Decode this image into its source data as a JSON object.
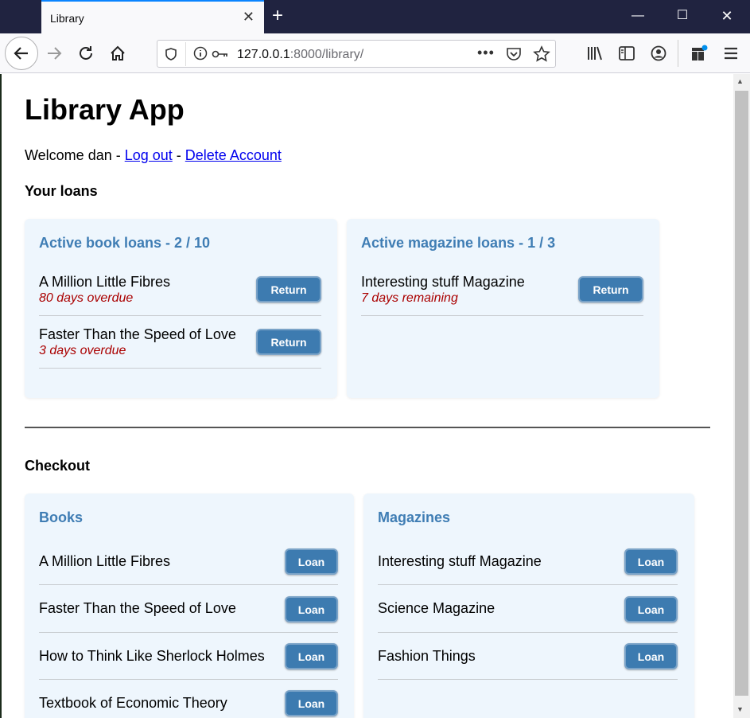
{
  "browser": {
    "tab_title": "Library",
    "url_host": "127.0.0.1",
    "url_rest": ":8000/library/"
  },
  "page": {
    "title": "Library App",
    "welcome_prefix": "Welcome dan - ",
    "logout": "Log out",
    "sep": " - ",
    "delete": "Delete Account",
    "loans_heading": "Your loans",
    "checkout_heading": "Checkout"
  },
  "loans": {
    "books": {
      "heading": "Active book loans - 2 / 10",
      "items": [
        {
          "name": "A Million Little Fibres",
          "status": "80 days overdue",
          "button": "Return"
        },
        {
          "name": "Faster Than the Speed of Love",
          "status": "3 days overdue",
          "button": "Return"
        }
      ]
    },
    "magazines": {
      "heading": "Active magazine loans - 1 / 3",
      "items": [
        {
          "name": "Interesting stuff Magazine",
          "status": "7 days remaining",
          "button": "Return"
        }
      ]
    }
  },
  "checkout": {
    "books": {
      "heading": "Books",
      "items": [
        {
          "name": "A Million Little Fibres",
          "button": "Loan"
        },
        {
          "name": "Faster Than the Speed of Love",
          "button": "Loan"
        },
        {
          "name": "How to Think Like Sherlock Holmes",
          "button": "Loan"
        },
        {
          "name": "Textbook of Economic Theory",
          "button": "Loan"
        }
      ]
    },
    "magazines": {
      "heading": "Magazines",
      "items": [
        {
          "name": "Interesting stuff Magazine",
          "button": "Loan"
        },
        {
          "name": "Science Magazine",
          "button": "Loan"
        },
        {
          "name": "Fashion Things",
          "button": "Loan"
        }
      ]
    }
  },
  "colors": {
    "accent": "#3f7db4",
    "button": "#3d7bb0",
    "overdue": "#aa0000",
    "card_bg": "#eef6fd"
  }
}
